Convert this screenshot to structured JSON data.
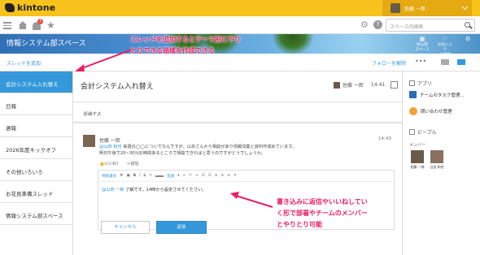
{
  "app": {
    "logo_text": "kintone"
  },
  "user": {
    "name": "佐藤 一郎"
  },
  "nav": {
    "notification_count": "3",
    "search_placeholder": "スペース内検索"
  },
  "space": {
    "title": "情報システム部スペース",
    "icons": [
      {
        "label_l1": "新公開",
        "label_l2": "スペース"
      },
      {
        "label_l1": "お気に入り",
        "label_l2": "に追加"
      },
      {
        "label_l1": "",
        "label_l2": ""
      }
    ]
  },
  "threadbar": {
    "add_thread": "スレッドを追加",
    "unfollow": "フォローを解除"
  },
  "sidebar": {
    "items": [
      {
        "label": "会計システム入れ替え"
      },
      {
        "label": "日報"
      },
      {
        "label": "週報"
      },
      {
        "label": "2026年度キックオフ"
      },
      {
        "label": "その他いろいろ"
      },
      {
        "label": "お花見準備スレッド"
      },
      {
        "label": "情報システム部スペース"
      }
    ]
  },
  "thread": {
    "title": "会計システム入れ替え",
    "author": "佐藤 一郎",
    "time": "14:41",
    "post_placeholder": "投稿する"
  },
  "comment": {
    "author": "佐藤 一郎",
    "time": "14:43",
    "mention": "@山田 和也",
    "line1_rest": " 来週の◯◯についてなんですが、山本さんから相談があり情報収集と資料作成めています。",
    "line2": "明日午後で20~30分お時間あるところで相談できればと思うのですがどうでしょうか。",
    "like": "いいね！",
    "reply_link": "返信"
  },
  "editor": {
    "toolbar_link": "特殊書式",
    "font_select": "普通",
    "mention": "@山田 一郎",
    "text": " 了解です。14時から設定させてください。"
  },
  "buttons": {
    "cancel": "キャンセル",
    "reply": "返信"
  },
  "rightpanel": {
    "apps_heading": "アプリ",
    "apps": [
      {
        "label": "チームのタスク管理..."
      },
      {
        "label": "問い合わせ管理"
      }
    ],
    "people_heading": "ピープル",
    "members_label": "メンバー",
    "members": [
      {
        "name": "佐藤 一郎"
      },
      {
        "name": "山田 和也"
      }
    ]
  },
  "annotations": {
    "top_line1": "スレッドを追加するとテーマ別にやり",
    "top_line2": "とりできる領域を作成できる",
    "bottom_line1": "書き込みに返信やいいねしてい",
    "bottom_line2": "く形で部署やチームのメンバー",
    "bottom_line3": "とやりとり可能"
  }
}
